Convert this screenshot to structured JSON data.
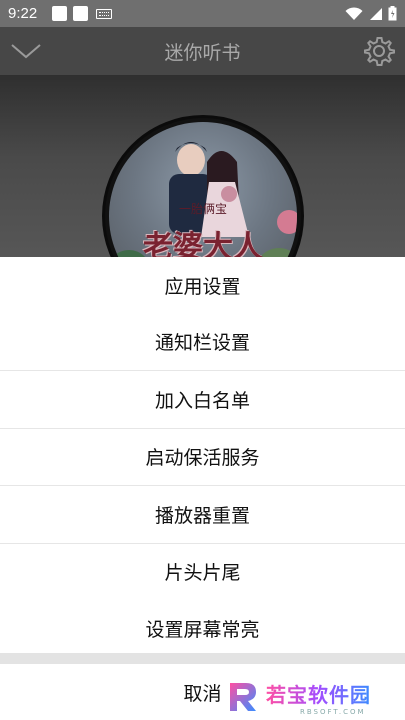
{
  "status_bar": {
    "time": "9:22"
  },
  "top_bar": {
    "title": "迷你听书"
  },
  "cover": {
    "subtitle": "一胎俩宝",
    "title": "老婆大人"
  },
  "menu": {
    "groups": [
      [
        "应用设置",
        "通知栏设置"
      ],
      [
        "加入白名单"
      ],
      [
        "启动保活服务"
      ],
      [
        "播放器重置"
      ],
      [
        "片头片尾",
        "设置屏幕常亮"
      ]
    ],
    "cancel_label": "取消"
  },
  "watermark": {
    "text": "若宝软件园",
    "sub": "RBSOFT.COM"
  },
  "colors": {
    "sheet_bg": "#ffffff",
    "overlay": "#474747",
    "title_text": "#a9a9a9"
  }
}
